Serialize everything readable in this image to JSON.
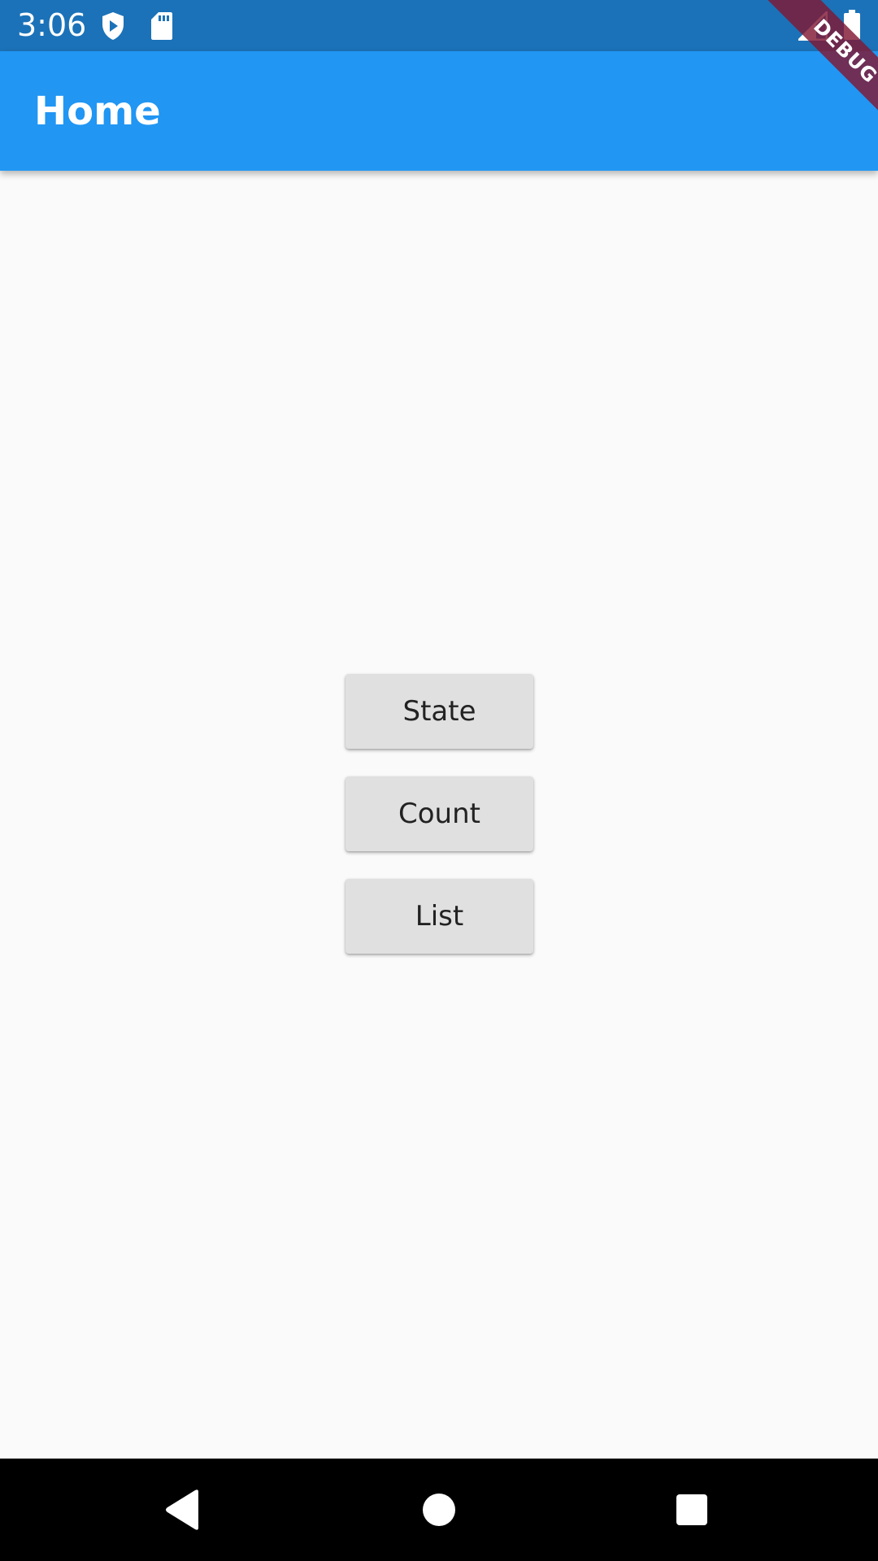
{
  "status_bar": {
    "time": "3:06",
    "icons": [
      "play-protect-icon",
      "sd-card-icon",
      "signal-icon",
      "battery-icon"
    ]
  },
  "debug_banner": {
    "label": "DEBUG"
  },
  "app_bar": {
    "title": "Home"
  },
  "buttons": {
    "state": "State",
    "count": "Count",
    "list": "List"
  },
  "nav_bar": {
    "icons": [
      "back-icon",
      "home-icon",
      "recents-icon"
    ]
  },
  "colors": {
    "status_bar": "#1b72b8",
    "app_bar": "#2196f3",
    "background": "#fafafa",
    "button": "#e0e0e0",
    "nav_bar": "#000000",
    "debug_ribbon": "#801834"
  }
}
